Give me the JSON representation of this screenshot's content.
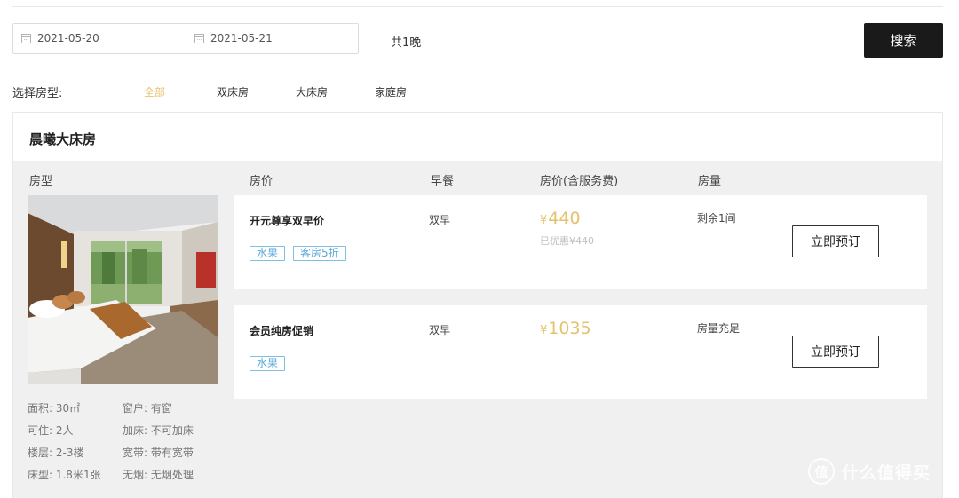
{
  "search": {
    "checkin": "2021-05-20",
    "checkout": "2021-05-21",
    "nights": "共1晚",
    "button_label": "搜索"
  },
  "filter": {
    "label": "选择房型:",
    "options": [
      "全部",
      "双床房",
      "大床房",
      "家庭房"
    ],
    "active_index": 0,
    "active_color": "#e5c16a"
  },
  "room": {
    "title": "晨曦大床房",
    "columns": [
      "房型",
      "房价",
      "早餐",
      "房价(含服务费)",
      "房量"
    ],
    "specs": [
      "面积: 30㎡",
      "窗户: 有窗",
      "可住: 2人",
      "加床: 不可加床",
      "楼层: 2-3楼",
      "宽带: 带有宽带",
      "床型: 1.8米1张",
      "无烟: 无烟处理"
    ],
    "rates": [
      {
        "name": "开元尊享双早价",
        "tags": [
          "水果",
          "客房5折"
        ],
        "breakfast": "双早",
        "currency": "¥",
        "price": "440",
        "discount": "已优惠¥440",
        "availability": "剩余1间",
        "button": "立即预订"
      },
      {
        "name": "会员纯房促销",
        "tags": [
          "水果"
        ],
        "breakfast": "双早",
        "currency": "¥",
        "price": "1035",
        "discount": "",
        "availability": "房量充足",
        "button": "立即预订"
      }
    ]
  },
  "watermark": {
    "logo": "值",
    "text": "什么值得买"
  },
  "colors": {
    "accent": "#e5c16a",
    "tag_blue": "#5aa9d6",
    "button_dark": "#1a1a1a"
  }
}
